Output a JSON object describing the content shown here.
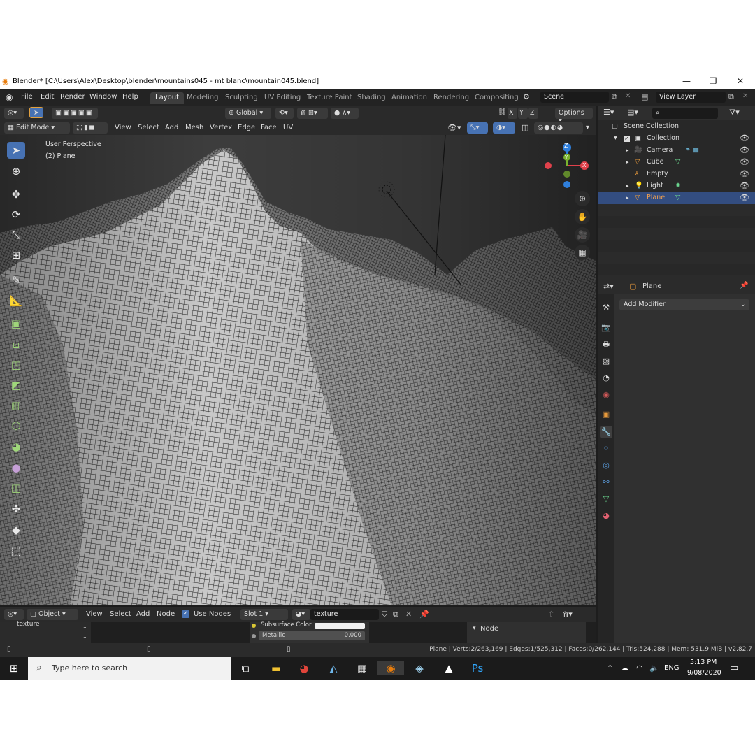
{
  "window": {
    "title": "Blender* [C:\\Users\\Alex\\Desktop\\blender\\mountains045 - mt blanc\\mountain045.blend]",
    "minimize": "—",
    "maximize": "❐",
    "close": "✕"
  },
  "topbar": {
    "menus": [
      "File",
      "Edit",
      "Render",
      "Window",
      "Help"
    ],
    "workspaces": [
      "Layout",
      "Modeling",
      "Sculpting",
      "UV Editing",
      "Texture Paint",
      "Shading",
      "Animation",
      "Rendering",
      "Compositing"
    ],
    "scene": "Scene",
    "view_layer": "View Layer"
  },
  "viewport_header": {
    "orientation": "Global",
    "options": "Options",
    "axis_x": "X",
    "axis_y": "Y",
    "axis_z": "Z",
    "mode": "Edit Mode",
    "menus": [
      "View",
      "Select",
      "Add",
      "Mesh",
      "Vertex",
      "Edge",
      "Face",
      "UV"
    ]
  },
  "viewport": {
    "perspective": "User Perspective",
    "object": "(2) Plane",
    "gizmo_z": "Z",
    "gizmo_y": "Y",
    "gizmo_x": "X"
  },
  "outliner": {
    "root": "Scene Collection",
    "collection": "Collection",
    "items": [
      {
        "name": "Camera",
        "icon": "camera-icon"
      },
      {
        "name": "Cube",
        "icon": "mesh-icon"
      },
      {
        "name": "Empty",
        "icon": "empty-icon"
      },
      {
        "name": "Light",
        "icon": "light-icon"
      },
      {
        "name": "Plane",
        "icon": "mesh-icon",
        "selected": true
      }
    ]
  },
  "properties": {
    "object": "Plane",
    "add_modifier": "Add Modifier"
  },
  "node_editor": {
    "mode": "Object",
    "menus": [
      "View",
      "Select",
      "Add",
      "Node"
    ],
    "use_nodes": "Use Nodes",
    "slot": "Slot 1",
    "material": "texture",
    "left_item": "texture",
    "subsurface_color": "Subsurface Color",
    "metallic": "Metallic",
    "metallic_value": "0.000",
    "panel_title": "Node"
  },
  "statusbar": {
    "stats": "Plane | Verts:2/263,169 | Edges:1/525,312 | Faces:0/262,144 | Tris:524,288 | Mem: 531.9 MiB | v2.82.7"
  },
  "taskbar": {
    "search_placeholder": "Type here to search",
    "language": "ENG",
    "time": "5:13 PM",
    "date": "9/08/2020"
  },
  "colors": {
    "accent": "#4772b3",
    "selected_row": "#334d80",
    "axis_x": "#e0414b",
    "axis_y": "#7ab32e",
    "axis_z": "#2f7fdb"
  }
}
